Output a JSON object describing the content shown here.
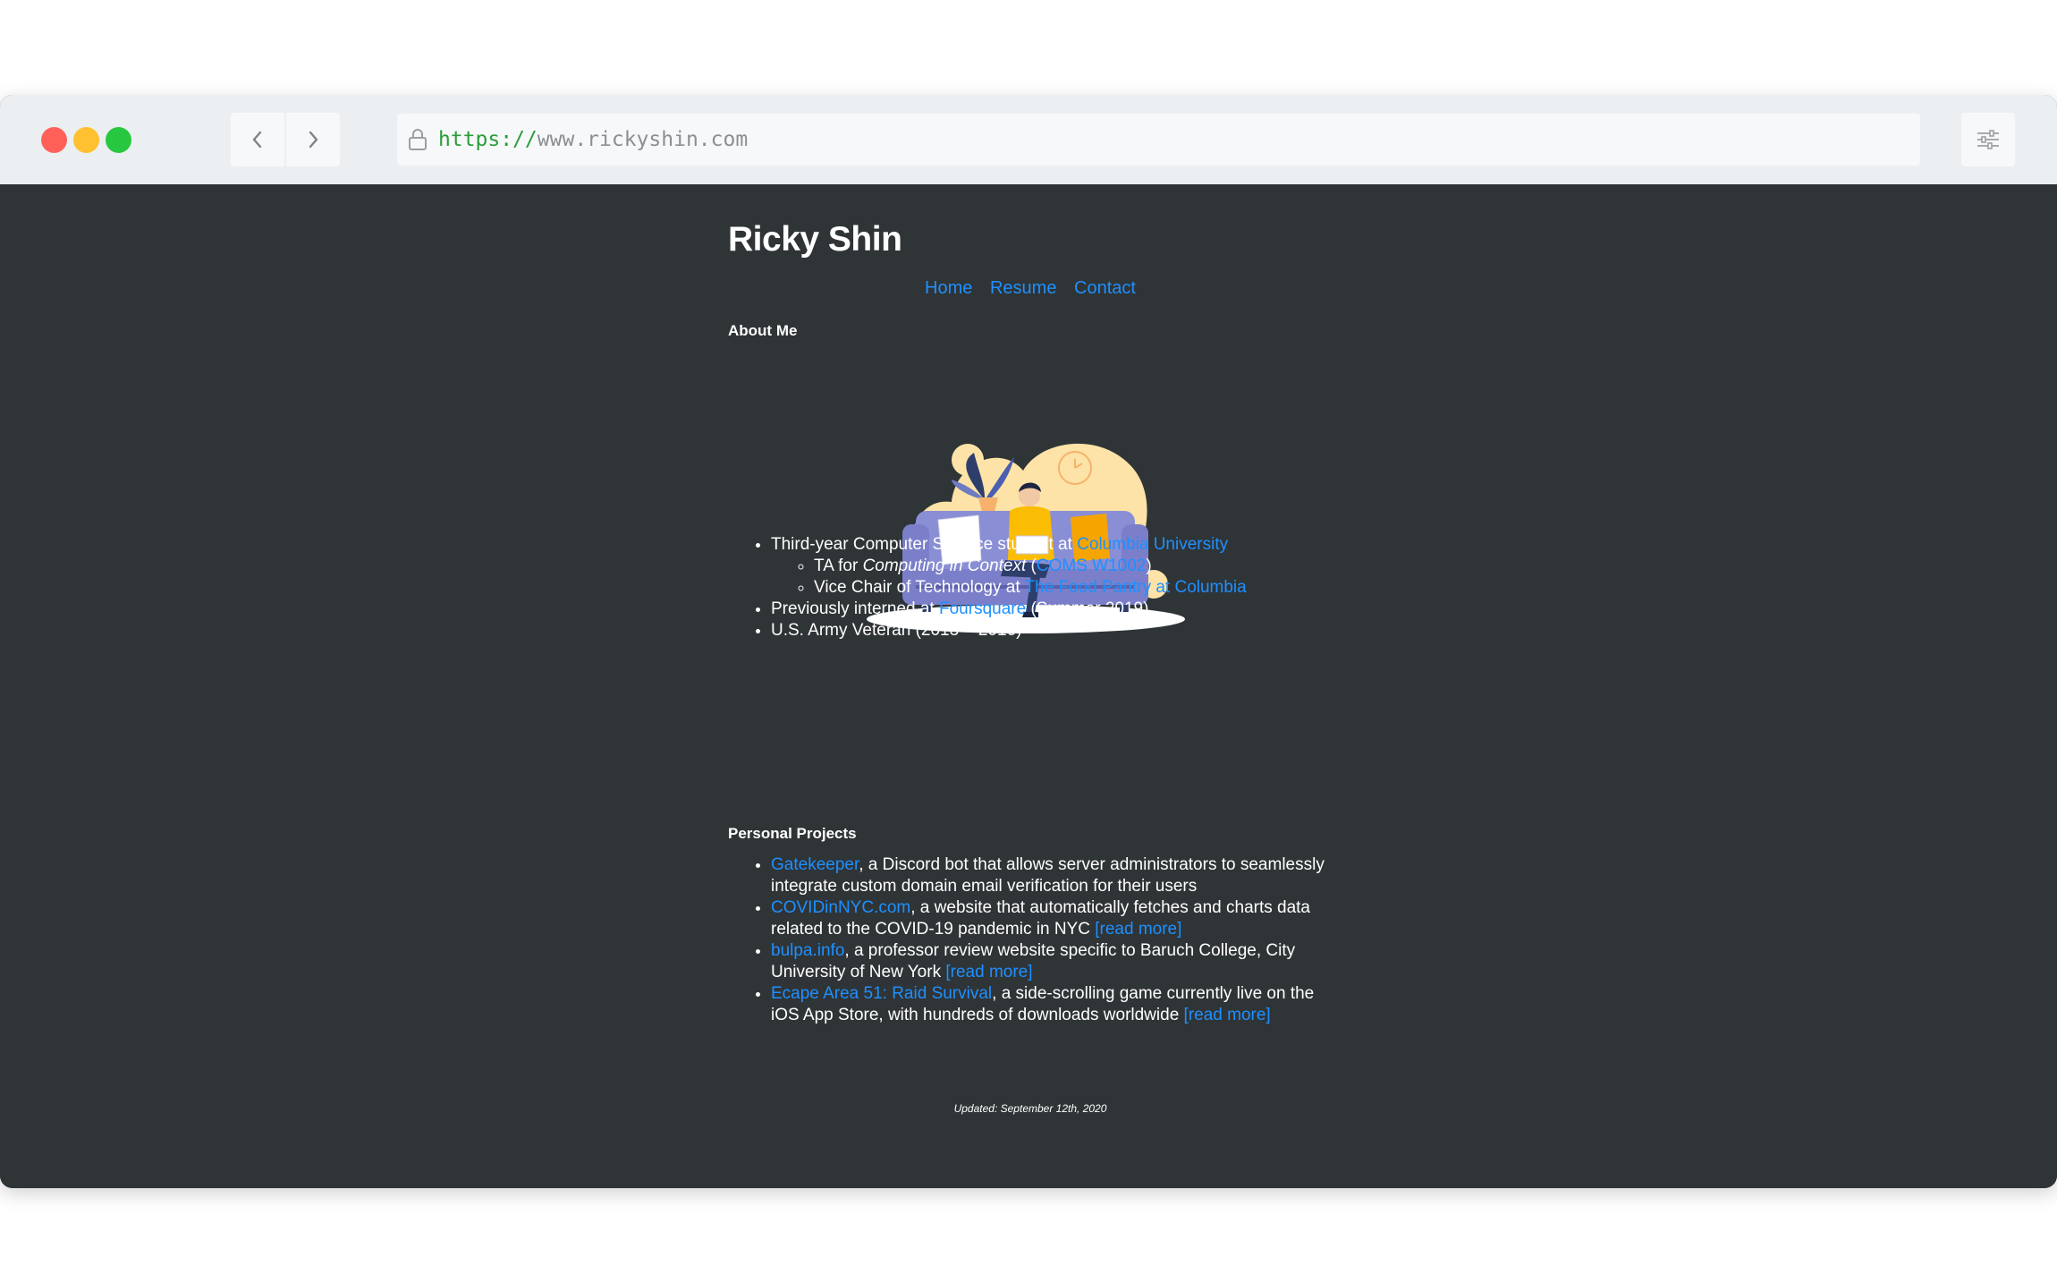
{
  "browser": {
    "url_scheme": "https://",
    "url_host": "www.rickyshin.com"
  },
  "site": {
    "title": "Ricky Shin",
    "nav": [
      {
        "label": "Home"
      },
      {
        "label": "Resume"
      },
      {
        "label": "Contact"
      }
    ],
    "about": {
      "heading": "About Me",
      "item1_text": "Third-year Computer Science student at ",
      "item1_link": "Columbia University",
      "sub1_prefix": "TA for ",
      "sub1_em": "Computing in Context",
      "sub1_open": " (",
      "sub1_link": "COMS W1002",
      "sub1_close": ")",
      "sub2_text": "Vice Chair of Technology at ",
      "sub2_link": "The Food Pantry at Columbia",
      "item2_text": "Previously interned at ",
      "item2_link": "Foursquare",
      "item2_suffix": " (Summer 2019)",
      "item3_text": "U.S. Army Veteran (2013 ~ 2016)"
    },
    "projects": {
      "heading": "Personal Projects",
      "p1_link": "Gatekeeper",
      "p1_text": ", a Discord bot that allows server administrators to seamlessly integrate custom domain email verification for their users",
      "p2_link": "COVIDinNYC.com",
      "p2_text": ", a website that automatically fetches and charts data related to the COVID-19 pandemic in NYC ",
      "p2_more": "[read more]",
      "p3_link": "bulpa.info",
      "p3_text": ", a professor review website specific to Baruch College, City University of New York ",
      "p3_more": "[read more]",
      "p4_link": "Ecape Area 51: Raid Survival",
      "p4_text": ", a side-scrolling game currently live on the iOS App Store, with hundreds of downloads worldwide ",
      "p4_more": "[read more]"
    },
    "updated": "Updated: September 12th, 2020"
  },
  "colors": {
    "page_bg": "#2f3437",
    "link": "#1e90ff",
    "accent_yellow": "#fde3a7",
    "sofa": "#7b7fc9"
  },
  "icons": {
    "back": "chevron-left-icon",
    "forward": "chevron-right-icon",
    "lock": "lock-icon",
    "settings": "sliders-icon"
  }
}
